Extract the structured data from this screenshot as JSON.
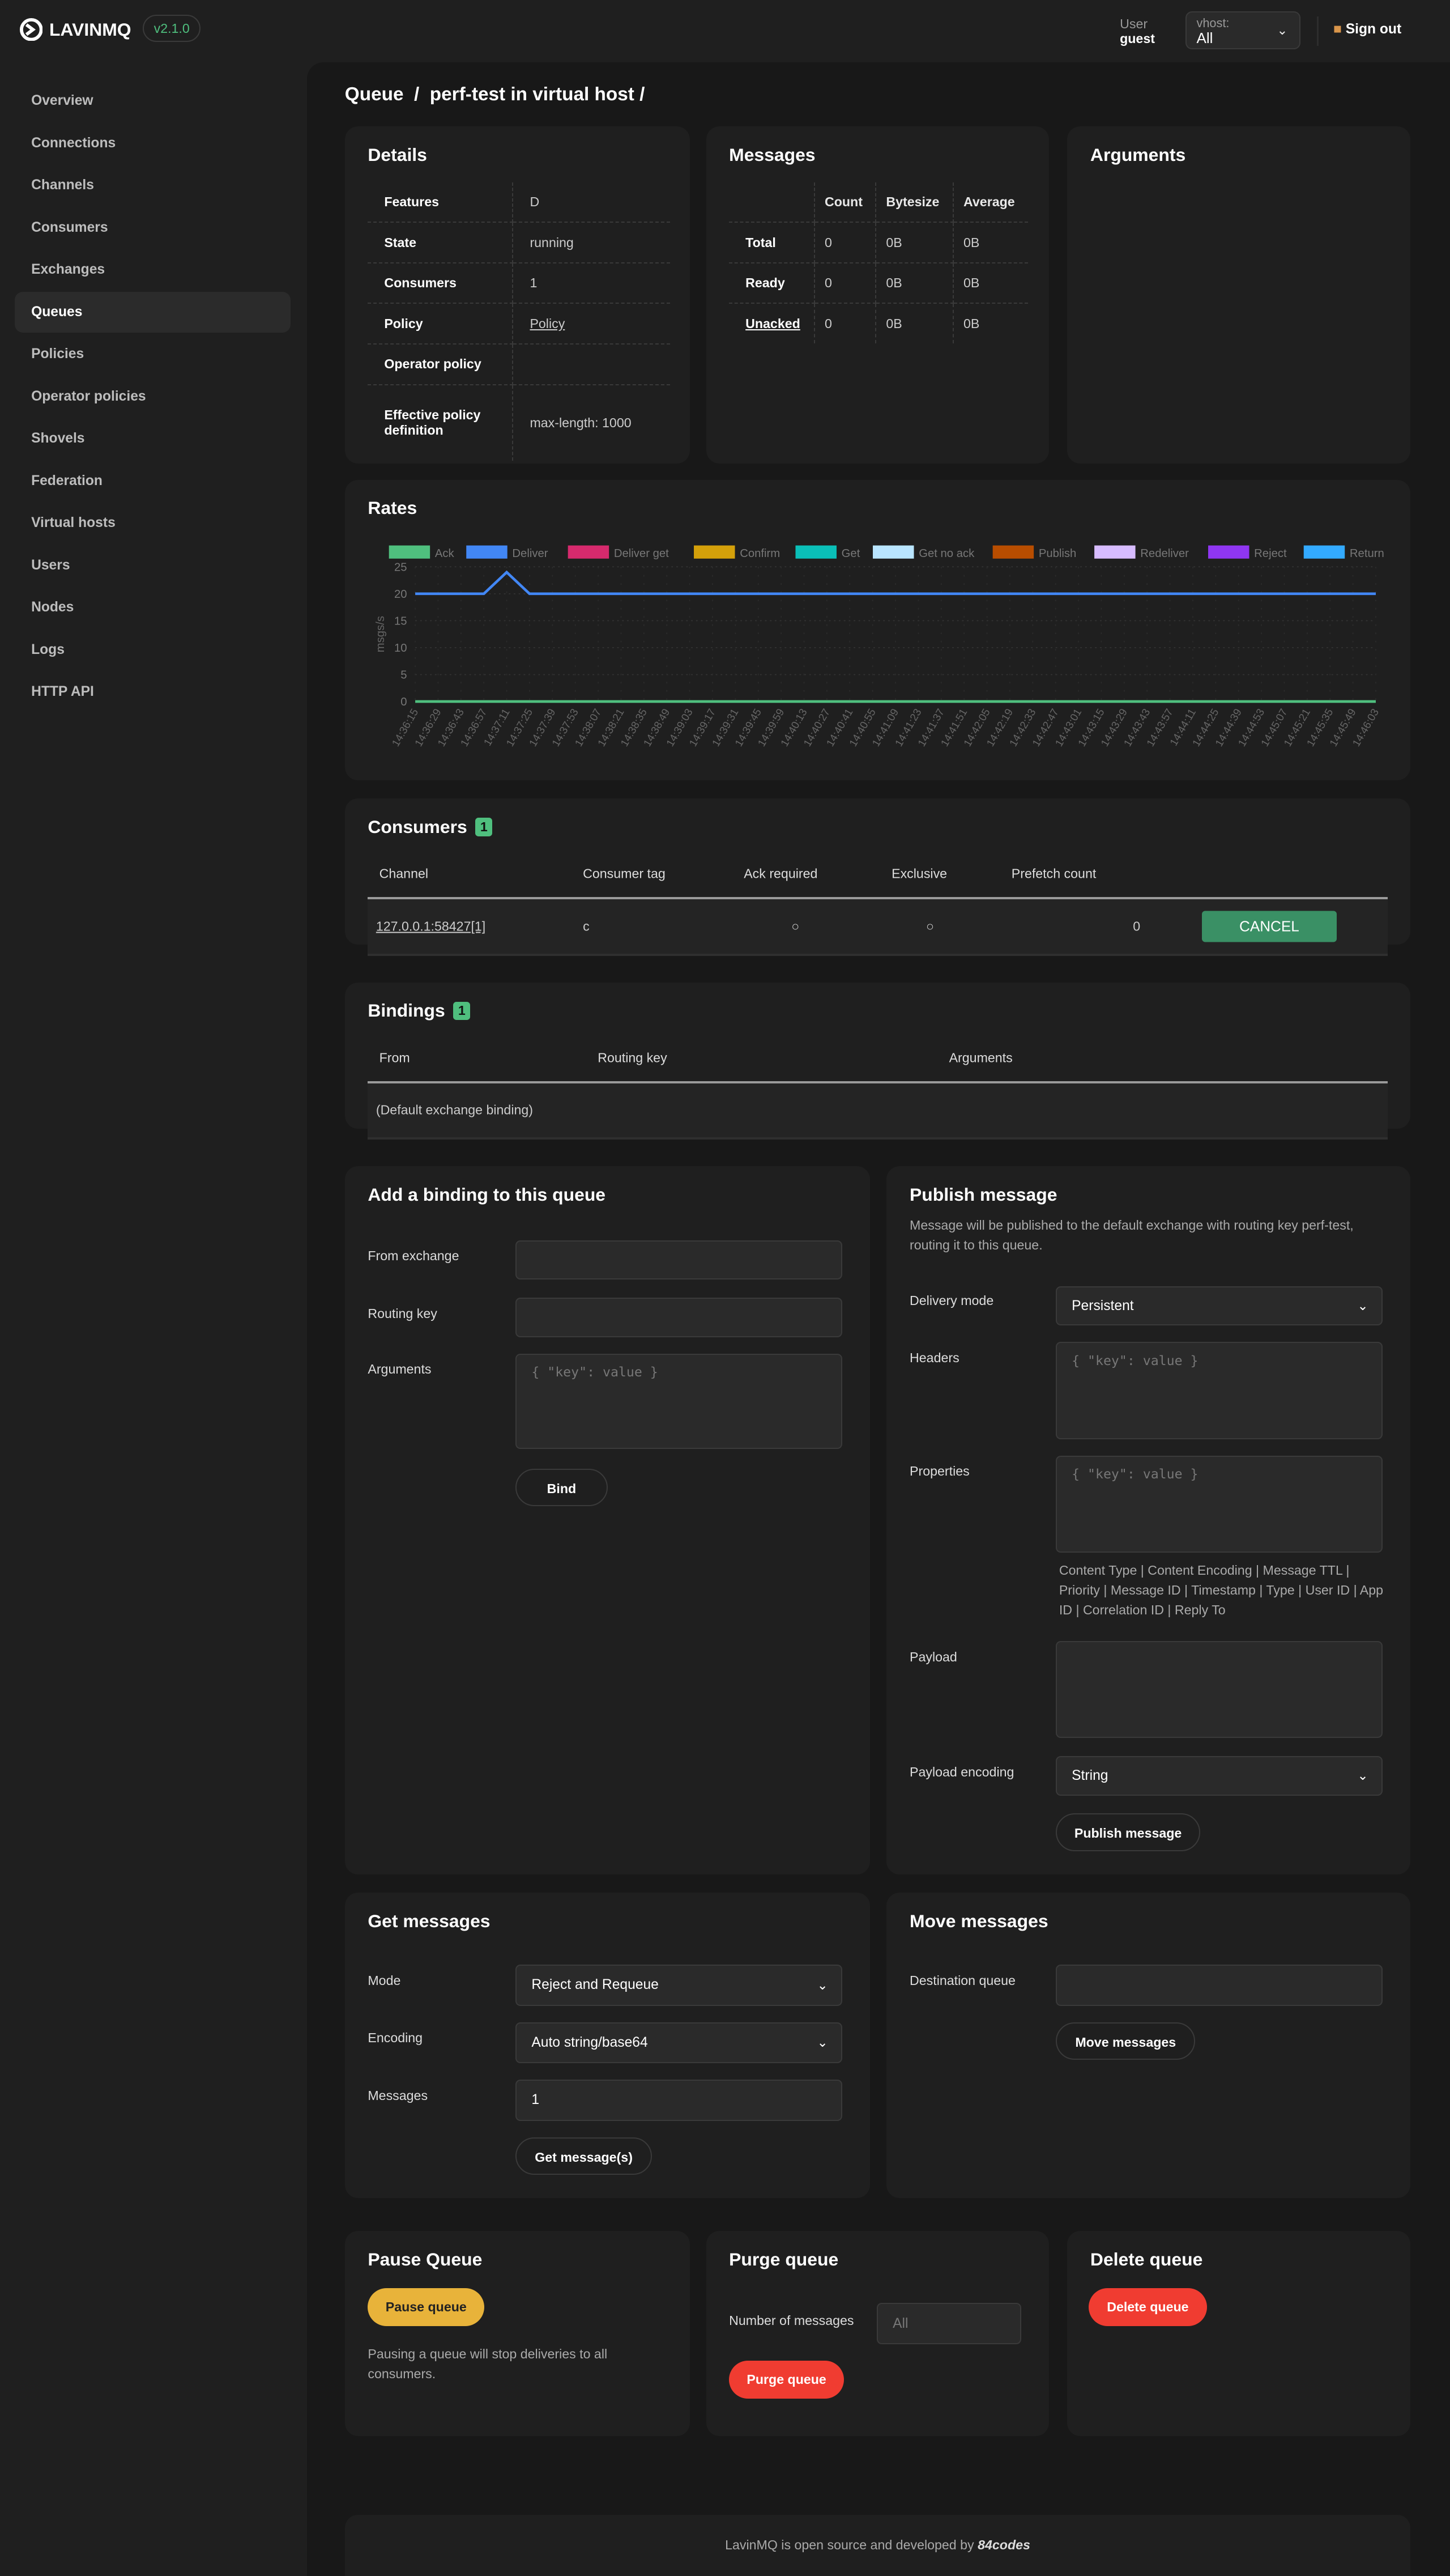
{
  "header": {
    "brand": "LAVINMQ",
    "version": "v2.1.0",
    "user_label": "User",
    "user": "guest",
    "vhost_label": "vhost:",
    "vhost_value": "All",
    "sign_out": "Sign out"
  },
  "sidebar": {
    "items": [
      {
        "label": "Overview"
      },
      {
        "label": "Connections"
      },
      {
        "label": "Channels"
      },
      {
        "label": "Consumers"
      },
      {
        "label": "Exchanges"
      },
      {
        "label": "Queues",
        "active": true
      },
      {
        "label": "Policies"
      },
      {
        "label": "Operator policies"
      },
      {
        "label": "Shovels"
      },
      {
        "label": "Federation"
      },
      {
        "label": "Virtual hosts"
      },
      {
        "label": "Users"
      },
      {
        "label": "Nodes"
      },
      {
        "label": "Logs"
      },
      {
        "label": "HTTP API"
      }
    ]
  },
  "page": {
    "title": "Queue  /  perf-test in virtual host /"
  },
  "details": {
    "title": "Details",
    "rows": [
      {
        "label": "Features",
        "value": "D"
      },
      {
        "label": "State",
        "value": "running"
      },
      {
        "label": "Consumers",
        "value": "1"
      },
      {
        "label": "Policy",
        "value": "Policy"
      },
      {
        "label": "Operator policy",
        "value": ""
      },
      {
        "label": "Effective policy definition",
        "value": "max-length: 1000"
      }
    ]
  },
  "messages": {
    "title": "Messages",
    "columns": [
      "Count",
      "Bytesize",
      "Average"
    ],
    "rows": [
      {
        "label": "Total",
        "values": [
          "0",
          "0B",
          "0B"
        ]
      },
      {
        "label": "Ready",
        "values": [
          "0",
          "0B",
          "0B"
        ]
      },
      {
        "label": "Unacked",
        "values": [
          "0",
          "0B",
          "0B"
        ]
      }
    ]
  },
  "arguments": {
    "title": "Arguments"
  },
  "rates": {
    "title": "Rates"
  },
  "chart_data": {
    "type": "line",
    "ylabel": "msgs/s",
    "ylim": [
      0,
      25
    ],
    "yticks": [
      0,
      5,
      10,
      15,
      20,
      25
    ],
    "grid": true,
    "legend": "top",
    "x": [
      "14:36:15",
      "14:36:29",
      "14:36:43",
      "14:36:57",
      "14:37:11",
      "14:37:25",
      "14:37:39",
      "14:37:53",
      "14:38:07",
      "14:38:21",
      "14:38:35",
      "14:38:49",
      "14:39:03",
      "14:39:17",
      "14:39:31",
      "14:39:45",
      "14:39:59",
      "14:40:13",
      "14:40:27",
      "14:40:41",
      "14:40:55",
      "14:41:09",
      "14:41:23",
      "14:41:37",
      "14:41:51",
      "14:42:05",
      "14:42:19",
      "14:42:33",
      "14:42:47",
      "14:43:01",
      "14:43:15",
      "14:43:29",
      "14:43:43",
      "14:43:57",
      "14:44:11",
      "14:44:25",
      "14:44:39",
      "14:44:53",
      "14:45:07",
      "14:45:21",
      "14:45:35",
      "14:45:49",
      "14:46:03"
    ],
    "series": [
      {
        "name": "Ack",
        "color": "#4fbf7e",
        "values": [
          0,
          0,
          0,
          0,
          0,
          0,
          0,
          0,
          0,
          0,
          0,
          0,
          0,
          0,
          0,
          0,
          0,
          0,
          0,
          0,
          0,
          0,
          0,
          0,
          0,
          0,
          0,
          0,
          0,
          0,
          0,
          0,
          0,
          0,
          0,
          0,
          0,
          0,
          0,
          0,
          0,
          0,
          0
        ]
      },
      {
        "name": "Deliver",
        "color": "#4287f5",
        "values": [
          20,
          20,
          20,
          20,
          24,
          20,
          20,
          20,
          20,
          20,
          20,
          20,
          20,
          20,
          20,
          20,
          20,
          20,
          20,
          20,
          20,
          20,
          20,
          20,
          20,
          20,
          20,
          20,
          20,
          20,
          20,
          20,
          20,
          20,
          20,
          20,
          20,
          20,
          20,
          20,
          20,
          20,
          20
        ]
      },
      {
        "name": "Deliver get",
        "color": "#d62a6d",
        "values": []
      },
      {
        "name": "Confirm",
        "color": "#d4a00a",
        "values": []
      },
      {
        "name": "Get",
        "color": "#0abfb8",
        "values": []
      },
      {
        "name": "Get no ack",
        "color": "#b9e5ff",
        "values": []
      },
      {
        "name": "Publish",
        "color": "#b84d00",
        "values": []
      },
      {
        "name": "Redeliver",
        "color": "#d7bcff",
        "values": []
      },
      {
        "name": "Reject",
        "color": "#8f36f2",
        "values": []
      },
      {
        "name": "Return unroutable",
        "color": "#33aaff",
        "values": []
      }
    ]
  },
  "consumers": {
    "title": "Consumers",
    "count": "1",
    "columns": [
      "Channel",
      "Consumer tag",
      "Ack required",
      "Exclusive",
      "Prefetch count"
    ],
    "rows": [
      {
        "channel": "127.0.0.1:58427[1]",
        "tag": "c",
        "ack_required": "○",
        "exclusive": "○",
        "prefetch": "0",
        "action": "CANCEL"
      }
    ]
  },
  "bindings": {
    "title": "Bindings",
    "count": "1",
    "columns": [
      "From",
      "Routing key",
      "Arguments"
    ],
    "rows": [
      {
        "from": "(Default exchange binding)",
        "routing_key": "",
        "arguments": ""
      }
    ]
  },
  "add_binding": {
    "title": "Add a binding to this queue",
    "from_label": "From exchange",
    "routing_label": "Routing key",
    "args_label": "Arguments",
    "args_placeholder": "{ \"key\": value }",
    "submit": "Bind"
  },
  "publish": {
    "title": "Publish message",
    "description": "Message will be published to the default exchange with routing key perf-test, routing it to this queue.",
    "delivery_label": "Delivery mode",
    "delivery_value": "Persistent",
    "headers_label": "Headers",
    "headers_placeholder": "{ \"key\": value }",
    "properties_label": "Properties",
    "properties_placeholder": "{ \"key\": value }",
    "properties_hint": "Content Type | Content Encoding | Message TTL | Priority | Message ID | Timestamp | Type | User ID | App ID | Correlation ID | Reply To",
    "payload_label": "Payload",
    "encoding_label": "Payload encoding",
    "encoding_value": "String",
    "submit": "Publish message"
  },
  "get": {
    "title": "Get messages",
    "mode_label": "Mode",
    "mode_value": "Reject and Requeue",
    "encoding_label": "Encoding",
    "encoding_value": "Auto string/base64",
    "messages_label": "Messages",
    "messages_value": "1",
    "submit": "Get message(s)"
  },
  "move": {
    "title": "Move messages",
    "dest_label": "Destination queue",
    "submit": "Move messages"
  },
  "pause": {
    "title": "Pause Queue",
    "submit": "Pause queue",
    "description": "Pausing a queue will stop deliveries to all consumers.",
    "color": "#e8b33a"
  },
  "purge": {
    "title": "Purge queue",
    "count_label": "Number of messages",
    "count_placeholder": "All",
    "submit": "Purge queue",
    "color": "#f03c31"
  },
  "delete": {
    "title": "Delete queue",
    "submit": "Delete queue",
    "color": "#f03c31"
  },
  "footer": {
    "text": "LavinMQ is open source and developed by",
    "brand": "84codes"
  }
}
